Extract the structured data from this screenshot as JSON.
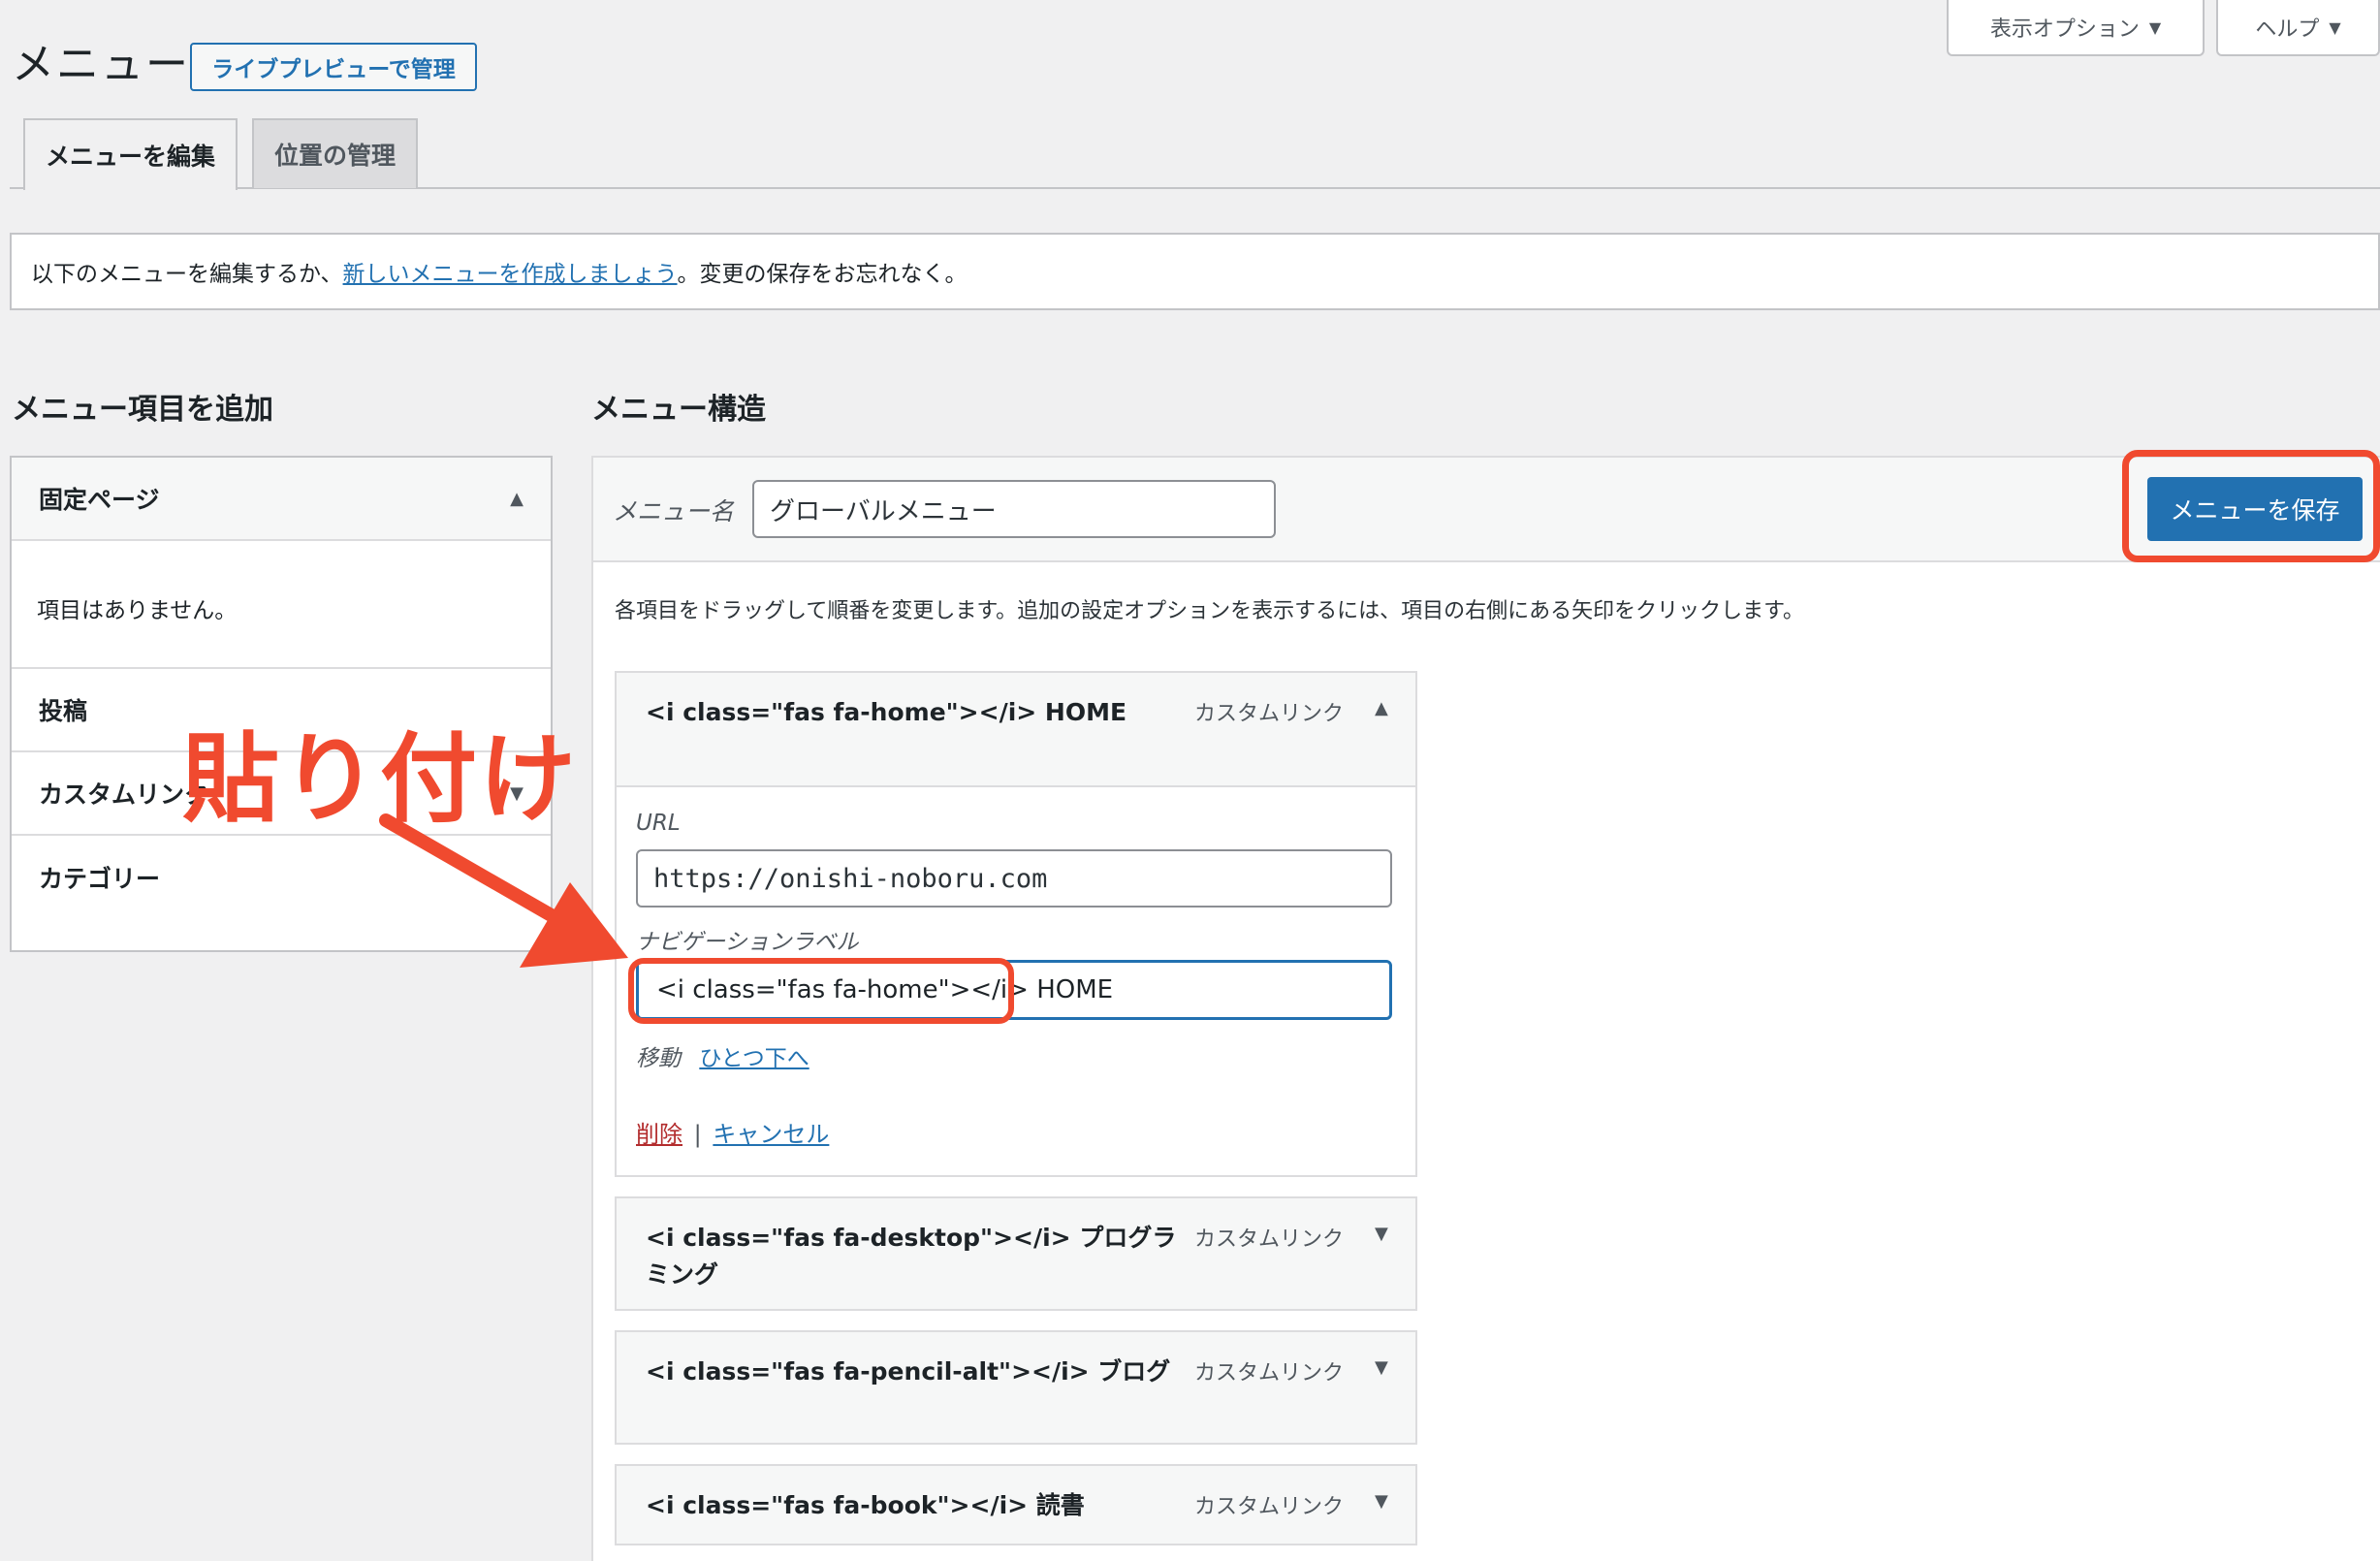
{
  "screen_meta": {
    "options_label": "表示オプション",
    "help_label": "ヘルプ"
  },
  "header": {
    "title": "メニュー",
    "live_preview_label": "ライブプレビューで管理"
  },
  "tabs": [
    {
      "label": "メニューを編集"
    },
    {
      "label": "位置の管理"
    }
  ],
  "notice": {
    "before": "以下のメニューを編集するか、",
    "link": "新しいメニューを作成しましょう",
    "after": "。変更の保存をお忘れなく。"
  },
  "left_panel": {
    "heading": "メニュー項目を追加",
    "sections": [
      {
        "label": "固定ページ"
      },
      {
        "label": "投稿"
      },
      {
        "label": "カスタムリンク"
      },
      {
        "label": "カテゴリー"
      }
    ],
    "empty_text": "項目はありません。"
  },
  "right_panel": {
    "heading": "メニュー構造",
    "menu_name_label": "メニュー名",
    "menu_name_value": "グローバルメニュー",
    "save_label": "メニューを保存",
    "instructions": "各項目をドラッグして順番を変更します。追加の設定オプションを表示するには、項目の右側にある矢印をクリックします。"
  },
  "menu_items": [
    {
      "title": "<i class=\"fas fa-home\"></i> HOME",
      "type": "カスタムリンク",
      "url_label": "URL",
      "url_value": "https://onishi-noboru.com",
      "nav_label": "ナビゲーションラベル",
      "nav_value": "<i class=\"fas fa-home\"></i> HOME",
      "move_label": "移動",
      "move_link": "ひとつ下へ",
      "delete_label": "削除",
      "separator": "|",
      "cancel_label": "キャンセル"
    },
    {
      "title": "<i class=\"fas fa-desktop\"></i> プログラミング",
      "type": "カスタムリンク"
    },
    {
      "title": "<i class=\"fas fa-pencil-alt\"></i> ブログ",
      "type": "カスタムリンク"
    },
    {
      "title": "<i class=\"fas fa-book\"></i> 読書",
      "type": "カスタムリンク"
    }
  ],
  "annotation": {
    "text": "貼り付け"
  },
  "colors": {
    "accent": "#2271b1",
    "annotation": "#f04a2f",
    "background": "#f0f0f1"
  }
}
